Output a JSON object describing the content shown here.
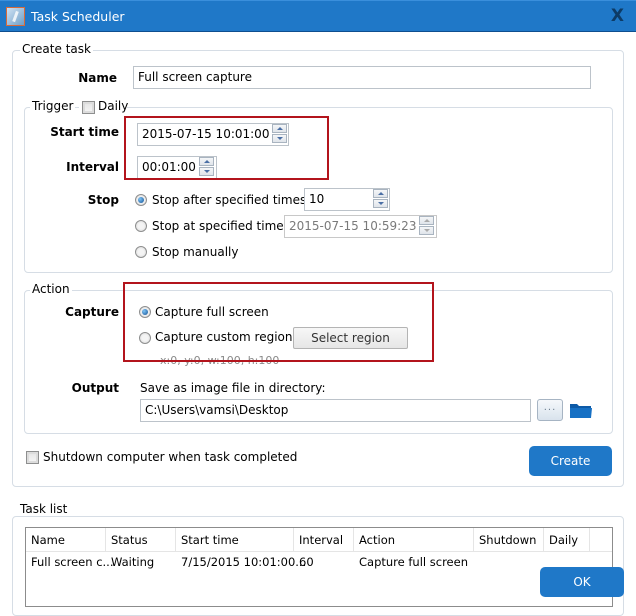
{
  "window": {
    "title": "Task Scheduler",
    "icon": "task-scheduler-app-icon",
    "close_label": "X"
  },
  "create_task": {
    "legend": "Create task",
    "name_label": "Name",
    "name_value": "Full screen capture",
    "trigger": {
      "legend": "Trigger",
      "daily_label": "Daily",
      "daily_checked": false,
      "start_time_label": "Start time",
      "start_time_value": "2015-07-15 10:01:00",
      "interval_label": "Interval",
      "interval_value": "00:01:00",
      "stop_label": "Stop",
      "stop_options": [
        {
          "label": "Stop after specified times:",
          "checked": true,
          "value": "10",
          "enabled": true
        },
        {
          "label": "Stop at specified time:",
          "checked": false,
          "value": "2015-07-15 10:59:23",
          "enabled": false
        },
        {
          "label": "Stop manually",
          "checked": false
        }
      ]
    },
    "action": {
      "legend": "Action",
      "capture_label": "Capture",
      "capture_options": [
        {
          "label": "Capture full screen",
          "checked": true
        },
        {
          "label": "Capture custom region",
          "checked": false
        }
      ],
      "select_region_label": "Select region",
      "region_hint": "x:0, y:0, w:100, h:100",
      "output_label": "Output",
      "output_desc": "Save as image file in directory:",
      "output_path": "C:\\Users\\vamsi\\Desktop",
      "browse_label": "...",
      "folder_icon": "folder-icon"
    },
    "shutdown_label": "Shutdown computer when task completed",
    "shutdown_checked": false,
    "create_label": "Create"
  },
  "task_list": {
    "legend": "Task list",
    "columns": [
      "Name",
      "Status",
      "Start time",
      "Interval",
      "Action",
      "Shutdown",
      "Daily"
    ],
    "rows": [
      [
        "Full screen c...",
        "Waiting",
        "7/15/2015 10:01:00...",
        "60",
        "Capture full screen",
        "",
        ""
      ]
    ]
  },
  "ok_label": "OK",
  "colors": {
    "accent": "#1f78c8",
    "highlight_box": "#b3141c"
  }
}
